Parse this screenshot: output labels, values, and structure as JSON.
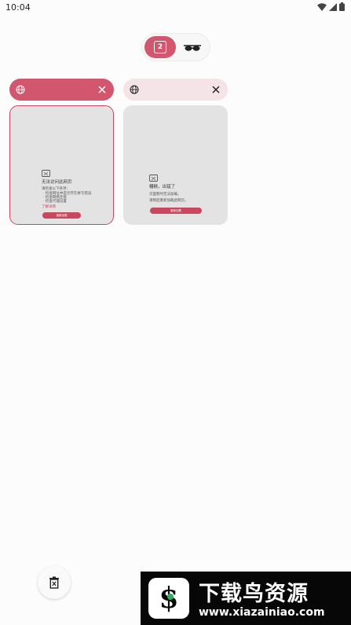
{
  "status_bar": {
    "time": "10:04"
  },
  "tab_switcher": {
    "tab_count": "2"
  },
  "tabs": [
    {
      "active": true,
      "preview": {
        "heading": "无法访问此网页",
        "body_intro": "请检查以下各项：",
        "bullets": [
          "· 检查网址中是否存在拼写错误",
          "· 检查网络连接",
          "· 检查代理设置"
        ],
        "link": "了解详情",
        "button": "重新加载"
      }
    },
    {
      "active": false,
      "preview": {
        "heading": "糟糕，出错了",
        "body_intro": "页面暂时无法加载。",
        "bullets": [
          "请稍后重新加载此网页。"
        ],
        "link": "",
        "button": "重新加载"
      }
    }
  ],
  "watermark": {
    "title": "下载鸟资源",
    "url": "www.xiazainiao.com"
  },
  "colors": {
    "accent": "#d2566e",
    "accent_light": "#f5e4e7",
    "thumb_bg": "#e3e3e3"
  }
}
